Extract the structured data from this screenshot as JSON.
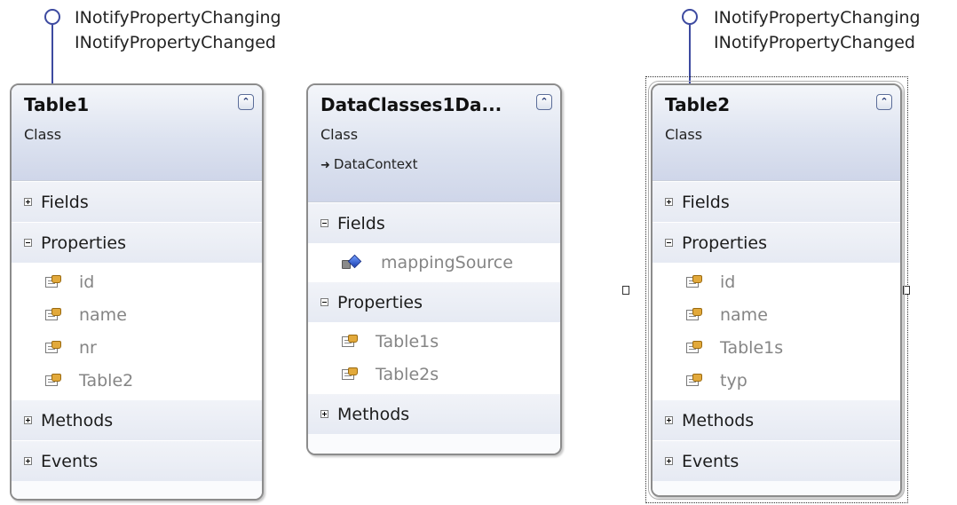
{
  "interfaces": [
    {
      "names": [
        "INotifyPropertyChanging",
        "INotifyPropertyChanged"
      ]
    },
    {
      "names": [
        "INotifyPropertyChanging",
        "INotifyPropertyChanged"
      ]
    }
  ],
  "classes": [
    {
      "name": "Table1",
      "stereotype": "Class",
      "sections": {
        "fields": "Fields",
        "properties": "Properties",
        "methods": "Methods",
        "events": "Events"
      },
      "properties": [
        "id",
        "name",
        "nr",
        "Table2"
      ]
    },
    {
      "name": "DataClasses1Da...",
      "stereotype": "Class",
      "base": "DataContext",
      "sections": {
        "fields": "Fields",
        "properties": "Properties",
        "methods": "Methods"
      },
      "fields": [
        "mappingSource"
      ],
      "properties": [
        "Table1s",
        "Table2s"
      ]
    },
    {
      "name": "Table2",
      "stereotype": "Class",
      "sections": {
        "fields": "Fields",
        "properties": "Properties",
        "methods": "Methods",
        "events": "Events"
      },
      "properties": [
        "id",
        "name",
        "Table1s",
        "typ"
      ]
    }
  ],
  "colors": {
    "interface_line": "#3d4aa0",
    "header_gradient_bottom": "#cfd6e9",
    "member_text": "#858585"
  },
  "icons": {
    "interface": "lollipop-icon",
    "collapse": "double-chevron-up-icon",
    "expanded_section": "minus-box-icon",
    "collapsed_section": "plus-box-icon",
    "property": "property-icon",
    "field": "private-field-icon",
    "base_class": "inheritance-arrow-icon"
  }
}
